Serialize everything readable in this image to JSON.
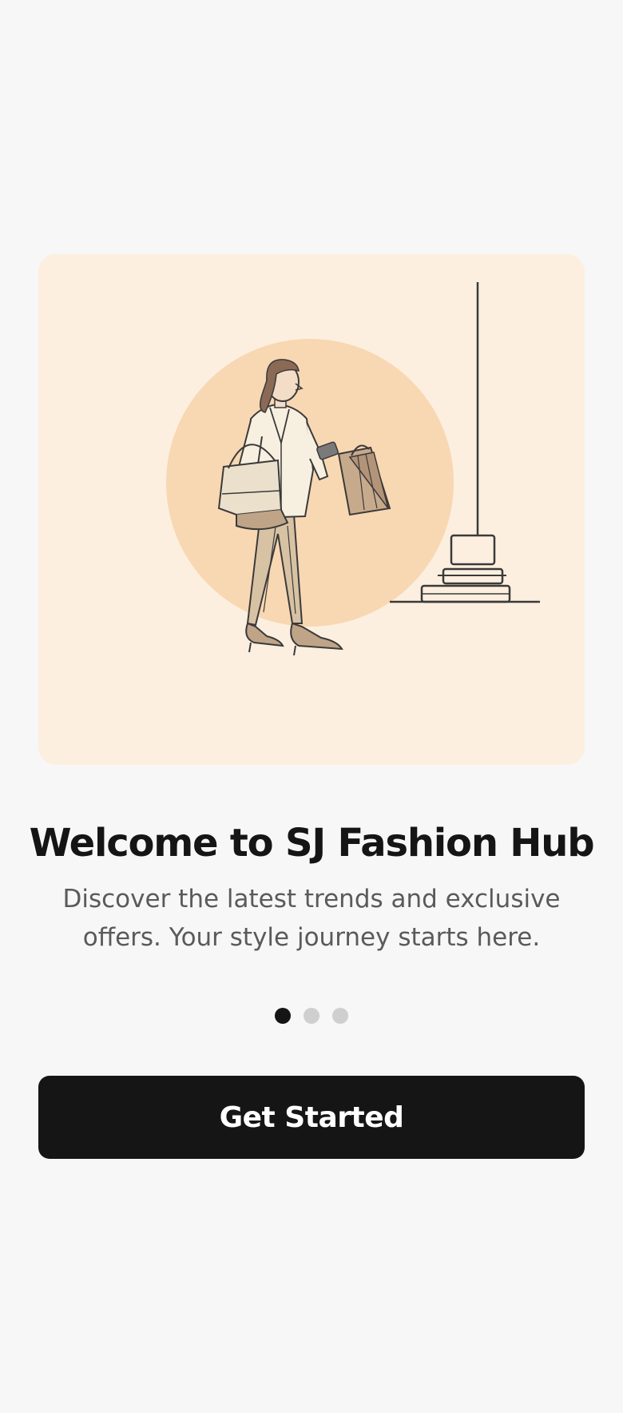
{
  "onboarding": {
    "illustration": {
      "icon": "woman-with-shopping-bags-illustration",
      "background_color": "#fcefdf",
      "circle_color": "#f8d7b3"
    },
    "title": "Welcome to SJ Fashion Hub",
    "subtitle": "Discover the latest trends and exclusive offers. Your style journey starts here.",
    "pagination": {
      "total": 3,
      "active_index": 0,
      "active_color": "#151515",
      "inactive_color": "#cfcfcf"
    },
    "cta_label": "Get Started"
  }
}
